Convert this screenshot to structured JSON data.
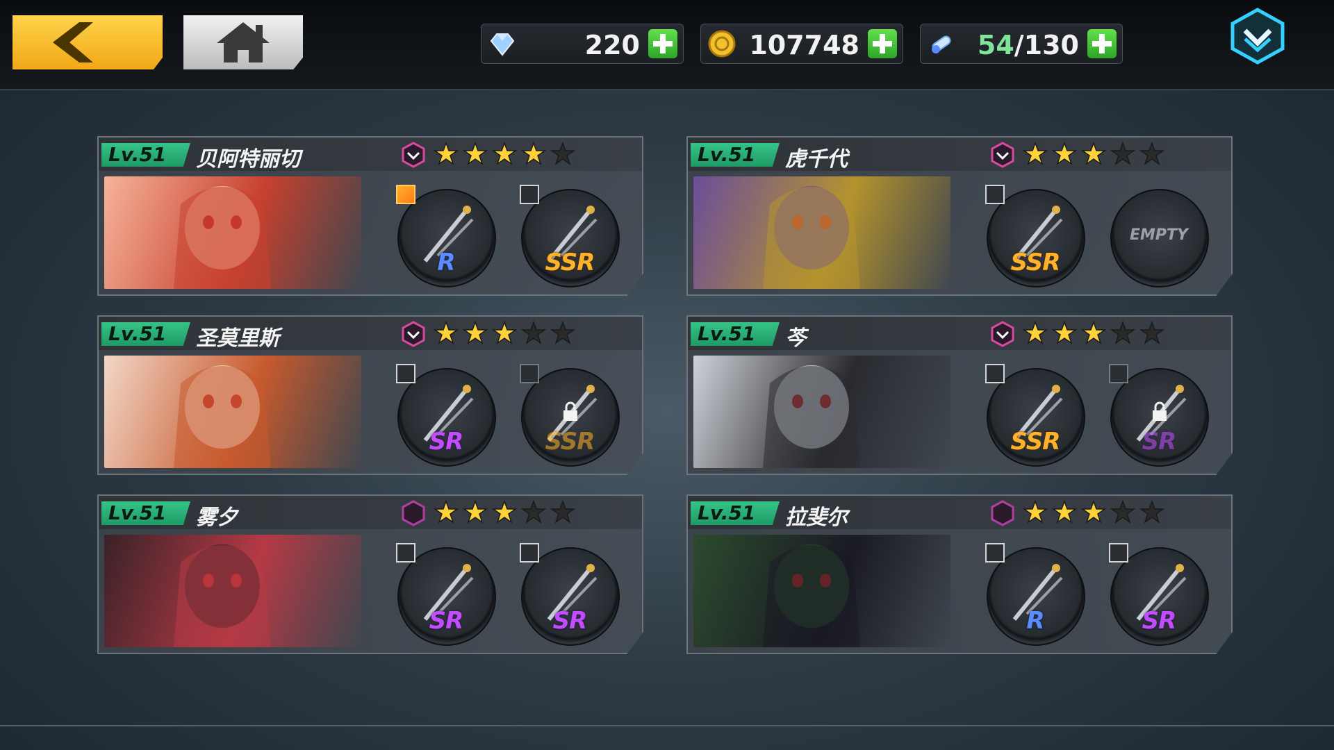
{
  "top_bar": {
    "resources": [
      {
        "icon": "diamond-icon",
        "value": "220"
      },
      {
        "icon": "gold-coin-icon",
        "value": "107748"
      },
      {
        "icon": "stamina-potion-icon",
        "current": "54",
        "separator": "/",
        "max": "130"
      }
    ]
  },
  "cards": [
    {
      "level": "Lv.51",
      "name": "贝阿特丽切",
      "stars": 4,
      "slots": [
        {
          "rarity": "R",
          "state": "equipped"
        },
        {
          "rarity": "SSR",
          "state": "equipped"
        }
      ]
    },
    {
      "level": "Lv.51",
      "name": "虎千代",
      "stars": 3,
      "slots": [
        {
          "rarity": "SSR",
          "state": "equipped"
        },
        {
          "rarity": "",
          "state": "empty",
          "label": "EMPTY"
        }
      ]
    },
    {
      "level": "Lv.51",
      "name": "圣莫里斯",
      "stars": 3,
      "slots": [
        {
          "rarity": "SR",
          "state": "equipped"
        },
        {
          "rarity": "SSR",
          "state": "locked"
        }
      ]
    },
    {
      "level": "Lv.51",
      "name": "芩",
      "stars": 3,
      "slots": [
        {
          "rarity": "SSR",
          "state": "equipped"
        },
        {
          "rarity": "SR",
          "state": "locked"
        }
      ]
    },
    {
      "level": "Lv.51",
      "name": "雾夕",
      "stars": 3,
      "slots": [
        {
          "rarity": "SR",
          "state": "equipped"
        },
        {
          "rarity": "SR",
          "state": "equipped"
        }
      ]
    },
    {
      "level": "Lv.51",
      "name": "拉斐尔",
      "stars": 3,
      "slots": [
        {
          "rarity": "R",
          "state": "equipped"
        },
        {
          "rarity": "SR",
          "state": "equipped"
        }
      ]
    }
  ],
  "colors": {
    "accent_green": "#35c486",
    "rarity_R": "#5b8cff",
    "rarity_SR": "#c14dff",
    "rarity_SSR": "#ffb22a",
    "star_gold": "#ffd23a",
    "star_dim": "#2a2a2a"
  }
}
